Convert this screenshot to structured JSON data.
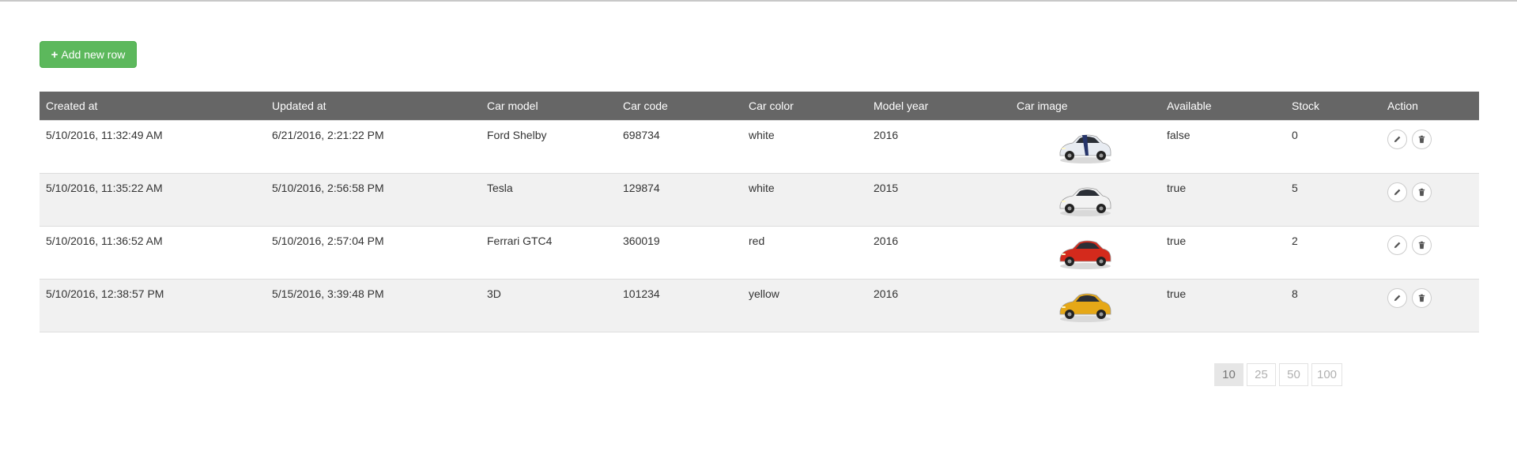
{
  "toolbar": {
    "add_label": "Add new row",
    "add_icon": "plus-icon"
  },
  "table": {
    "headers": [
      "Created at",
      "Updated at",
      "Car model",
      "Car code",
      "Car color",
      "Model year",
      "Car image",
      "Available",
      "Stock",
      "Action"
    ],
    "rows": [
      {
        "created": "5/10/2016, 11:32:49 AM",
        "updated": "6/21/2016, 2:21:22 PM",
        "model": "Ford Shelby",
        "code": "698734",
        "color": "white",
        "year": "2016",
        "image": "ford-shelby-white-car-image",
        "available": "false",
        "stock": "0"
      },
      {
        "created": "5/10/2016, 11:35:22 AM",
        "updated": "5/10/2016, 2:56:58 PM",
        "model": "Tesla",
        "code": "129874",
        "color": "white",
        "year": "2015",
        "image": "tesla-white-car-image",
        "available": "true",
        "stock": "5"
      },
      {
        "created": "5/10/2016, 11:36:52 AM",
        "updated": "5/10/2016, 2:57:04 PM",
        "model": "Ferrari GTC4",
        "code": "360019",
        "color": "red",
        "year": "2016",
        "image": "ferrari-red-car-image",
        "available": "true",
        "stock": "2"
      },
      {
        "created": "5/10/2016, 12:38:57 PM",
        "updated": "5/15/2016, 3:39:48 PM",
        "model": "3D",
        "code": "101234",
        "color": "yellow",
        "year": "2016",
        "image": "yellow-sports-car-image",
        "available": "true",
        "stock": "8"
      }
    ],
    "action_icons": [
      "pencil-icon",
      "trash-icon"
    ]
  },
  "pagination": {
    "sizes": [
      "10",
      "25",
      "50",
      "100"
    ],
    "selected": "10"
  },
  "colors": {
    "add_button": "#5cb85c",
    "header_bg": "#666666",
    "row_stripe": "#f1f1f1",
    "car_bodies": [
      "#e8ecf2",
      "#f2f2f2",
      "#d42a1c",
      "#e6a817"
    ],
    "car_stripes": [
      "#27356a",
      null,
      null,
      null
    ]
  }
}
